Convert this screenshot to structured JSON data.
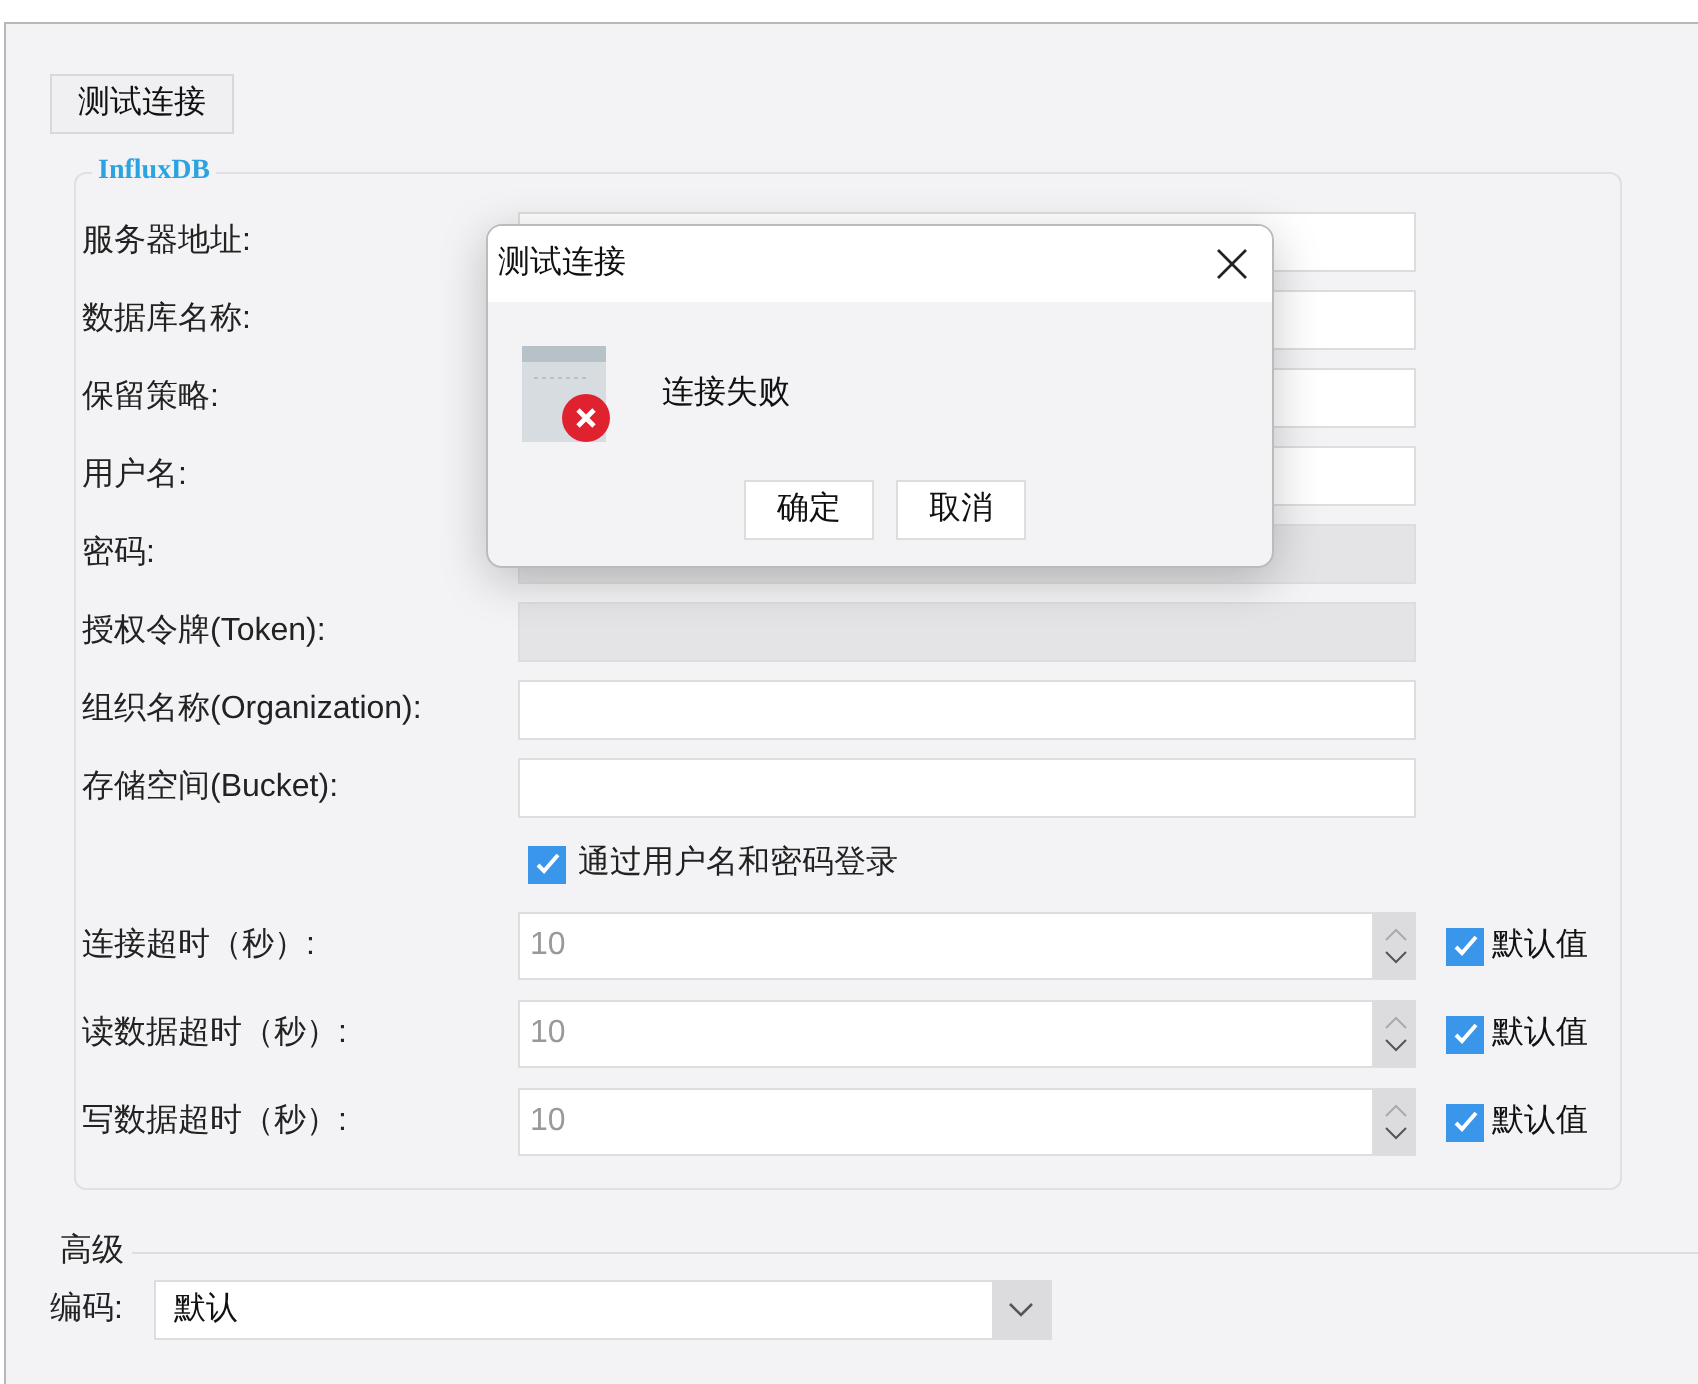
{
  "toolbar": {
    "test_button": "测试连接"
  },
  "group": {
    "legend": "InfluxDB",
    "fields": [
      {
        "label": "服务器地址:",
        "disabled": false
      },
      {
        "label": "数据库名称:",
        "disabled": false
      },
      {
        "label": "保留策略:",
        "disabled": false
      },
      {
        "label": "用户名:",
        "disabled": false
      },
      {
        "label": "密码:",
        "disabled": true
      },
      {
        "label": "授权令牌(Token):",
        "disabled": true
      },
      {
        "label": "组织名称(Organization):",
        "disabled": false
      },
      {
        "label": "存储空间(Bucket):",
        "disabled": false
      }
    ],
    "login_checkbox": {
      "label": "通过用户名和密码登录",
      "checked": true
    },
    "timeouts": [
      {
        "label": "连接超时（秒）:",
        "value": "10",
        "default_label": "默认值",
        "checked": true
      },
      {
        "label": "读数据超时（秒）:",
        "value": "10",
        "default_label": "默认值",
        "checked": true
      },
      {
        "label": "写数据超时（秒）:",
        "value": "10",
        "default_label": "默认值",
        "checked": true
      }
    ]
  },
  "advanced": {
    "title": "高级",
    "encoding": {
      "label": "编码:",
      "value": "默认"
    }
  },
  "dialog": {
    "title": "测试连接",
    "message": "连接失败",
    "buttons": [
      "确定",
      "取消"
    ]
  }
}
